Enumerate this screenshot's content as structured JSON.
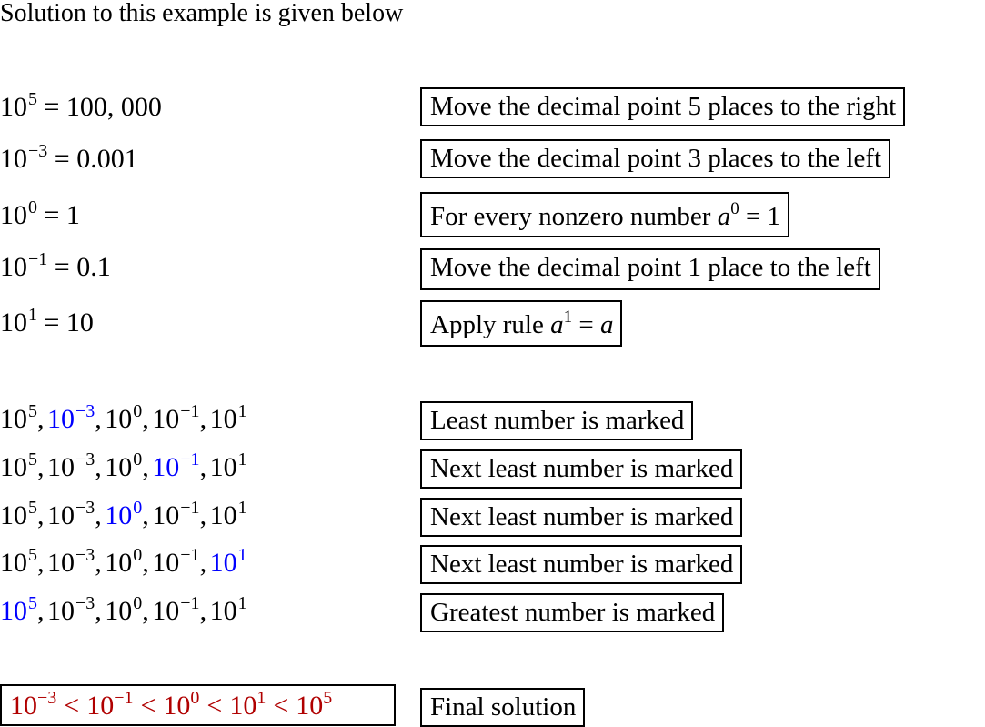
{
  "intro": "Solution to this example is given below",
  "equations": [
    {
      "base": "10",
      "exp": "5",
      "rhs": " = 100, 000",
      "note": "Move the decimal point 5 places to the right"
    },
    {
      "base": "10",
      "exp": "−3",
      "rhs": " = 0.001",
      "note": "Move the decimal point 3 places to the left"
    },
    {
      "base": "10",
      "exp": "0",
      "rhs": " = 1",
      "note_text": "For every nonzero number ",
      "note_var": "a",
      "note_exp": "0",
      "note_tail": " = 1"
    },
    {
      "base": "10",
      "exp": "−1",
      "rhs": " = 0.1",
      "note": "Move the decimal point 1 place to the left"
    },
    {
      "base": "10",
      "exp": "1",
      "rhs": " = 10",
      "note_text": "Apply rule ",
      "note_var": "a",
      "note_exp": "1",
      "note_tail": " = ",
      "note_tail_var": "a"
    }
  ],
  "ordering_terms": [
    {
      "base": "10",
      "exp": "5"
    },
    {
      "base": "10",
      "exp": "−3"
    },
    {
      "base": "10",
      "exp": "0"
    },
    {
      "base": "10",
      "exp": "−1"
    },
    {
      "base": "10",
      "exp": "1"
    }
  ],
  "ordering_steps": [
    {
      "highlight_index": 1,
      "note": "Least number is marked"
    },
    {
      "highlight_index": 3,
      "note": "Next least number is marked"
    },
    {
      "highlight_index": 2,
      "note": "Next least number is marked"
    },
    {
      "highlight_index": 4,
      "note": "Next least number is marked"
    },
    {
      "highlight_index": 0,
      "note": "Greatest number is marked"
    }
  ],
  "final": {
    "terms": [
      {
        "base": "10",
        "exp": "−3"
      },
      {
        "base": "10",
        "exp": "−1"
      },
      {
        "base": "10",
        "exp": "0"
      },
      {
        "base": "10",
        "exp": "1"
      },
      {
        "base": "10",
        "exp": "5"
      }
    ],
    "relation": "<",
    "note": "Final solution"
  },
  "colors": {
    "highlight": "#0000ff",
    "answer": "#b00000",
    "text": "#000000"
  }
}
